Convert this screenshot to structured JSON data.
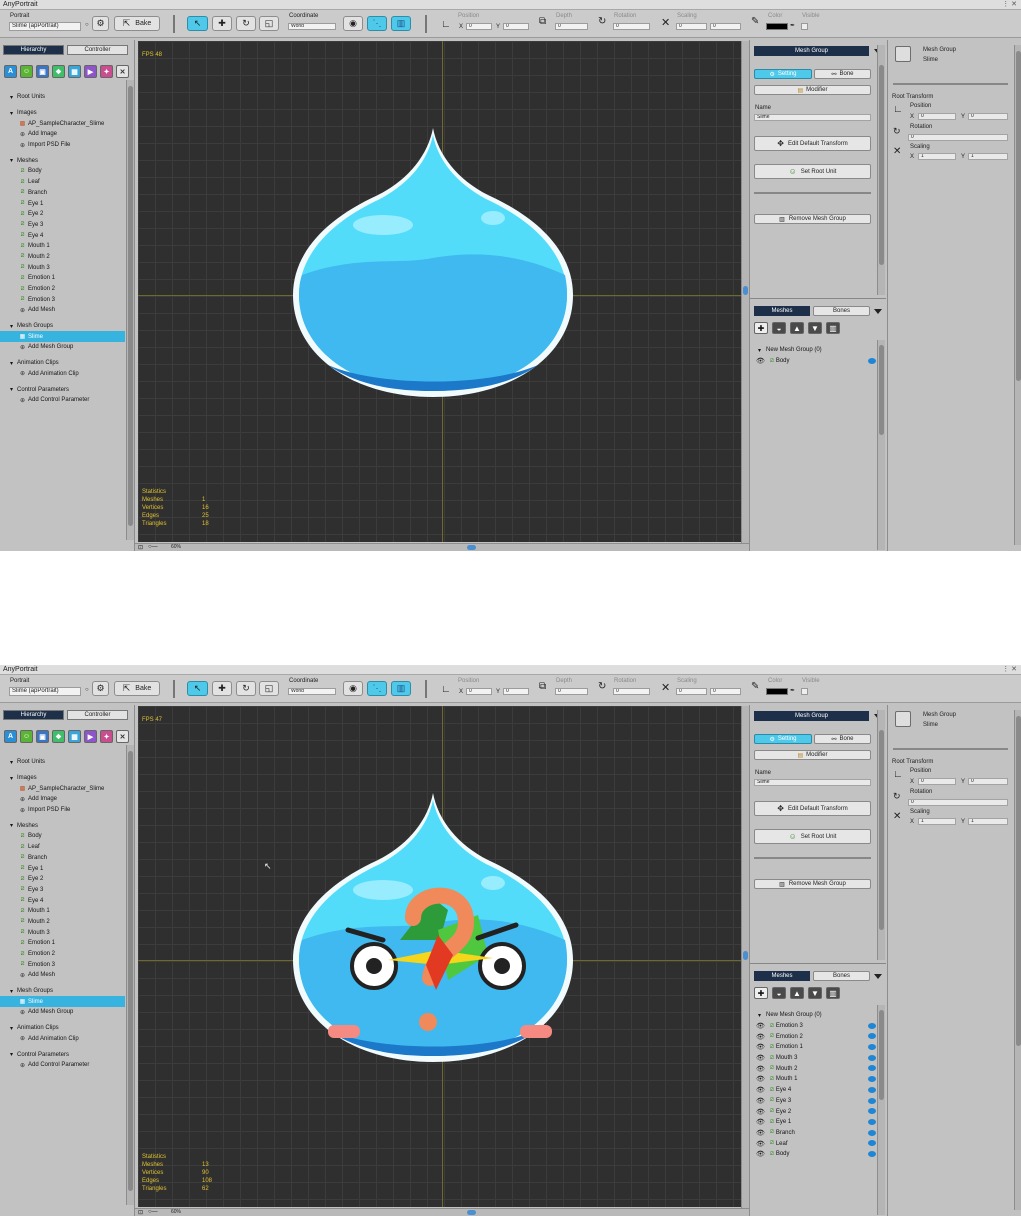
{
  "app_title": "AnyPortrait",
  "toolbar": {
    "portrait_label": "Portrait",
    "bake_label": "Bake",
    "coordinate_label": "Coordinate",
    "coordinate_value": "World",
    "position_label": "Position",
    "depth_label": "Depth",
    "rotation_label": "Rotation",
    "scaling_label": "Scaling",
    "color_label": "Color",
    "visible_label": "Visible",
    "x_label": "X",
    "y_label": "Y",
    "color_swatch": "#000000"
  },
  "left": {
    "tab_hierarchy": "Hierarchy",
    "tab_controller": "Controller",
    "root_units": "Root Units",
    "images_header": "Images",
    "images": [
      "AP_SampleCharacter_Slime",
      "Add Image",
      "Import PSD File"
    ],
    "meshes_header": "Meshes",
    "meshes": [
      "Body",
      "Leaf",
      "Branch",
      "Eye 1",
      "Eye 2",
      "Eye 3",
      "Eye 4",
      "Mouth 1",
      "Mouth 2",
      "Mouth 3",
      "Emotion 1",
      "Emotion 2",
      "Emotion 3"
    ],
    "add_mesh": "Add Mesh",
    "mesh_groups_header": "Mesh Groups",
    "mesh_group_item": "Slime",
    "add_mesh_group": "Add Mesh Group",
    "animation_clips_header": "Animation Clips",
    "add_animation_clip": "Add Animation Clip",
    "control_parameters_header": "Control Parameters",
    "add_control_parameter": "Add Control Parameter"
  },
  "middle": {
    "header": "Mesh Group",
    "setting_tab": "Setting",
    "bone_tab": "Bone",
    "modifier": "Modifier",
    "name_label": "Name",
    "name_value": "Slime",
    "edit_default_transform": "Edit Default Transform",
    "set_root_unit": "Set Root Unit",
    "remove_mesh_group": "Remove Mesh Group",
    "meshes_tab": "Meshes",
    "bones_tab": "Bones",
    "new_mesh_group": "New Mesh Group (0)"
  },
  "right": {
    "title_line1": "Mesh Group",
    "title_line2": "Slime",
    "root_transform": "Root Transform",
    "position_label": "Position",
    "rotation_label": "Rotation",
    "scaling_label": "Scaling",
    "pos_x": "0",
    "pos_y": "0",
    "rot": "0",
    "scale_x": "1",
    "scale_y": "1"
  },
  "statistics": {
    "title": "Statistics",
    "meshes_label": "Meshes",
    "vertices_label": "Vertices",
    "edges_label": "Edges",
    "triangles_label": "Triangles"
  },
  "shot1": {
    "portrait_value": "Slime (apPortrait)",
    "fps": "FPS 48",
    "zoom": "60%",
    "stats": {
      "meshes": "1",
      "vertices": "16",
      "edges": "25",
      "triangles": "18"
    },
    "mesh_list": [
      "Body"
    ]
  },
  "shot2": {
    "portrait_value": "Slime (apPortrait)",
    "fps": "FPS 47",
    "zoom": "60%",
    "stats": {
      "meshes": "13",
      "vertices": "90",
      "edges": "108",
      "triangles": "62"
    },
    "mesh_list": [
      "Emotion 3",
      "Emotion 2",
      "Emotion 1",
      "Mouth 3",
      "Mouth 2",
      "Mouth 1",
      "Eye 4",
      "Eye 3",
      "Eye 2",
      "Eye 1",
      "Branch",
      "Leaf",
      "Body"
    ]
  },
  "colors": {
    "accent": "#4ec9e9",
    "header": "#1d2f49",
    "selection": "#37b3e0",
    "canvas": "#2f2f2f",
    "stats_text": "#e1c232"
  }
}
